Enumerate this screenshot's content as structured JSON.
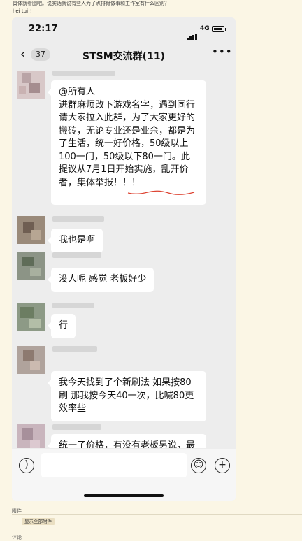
{
  "post": {
    "question": "具体就看图吧。说实话就说有些人为了点排骨做事和工作室有什么区别？",
    "subtext": "hei tui!!"
  },
  "status_bar": {
    "time": "22:17",
    "network": "4G"
  },
  "nav": {
    "back_count": "37",
    "title": "STSM交流群(11)",
    "more_label": "•••"
  },
  "messages": [
    {
      "text": "@所有人\n进群麻烦改下游戏名字，遇到同行请大家拉入此群，为了大家更好的搬砖，无论专业还是业余，都是为了生活，统一好价格，50级以上100一门，50级以下80一门。此提议从7月1日开始实施，乱开价者，集体举报！！！"
    },
    {
      "text": "我也是啊"
    },
    {
      "text": "没人呢 感觉  老板好少"
    },
    {
      "text": "行"
    },
    {
      "text": "我今天找到了个新刷法  如果按80刷 那我按今天40一次，比喊80更效率些"
    },
    {
      "text": "统一了价格，有没有老板另说，最起码不乱叫价了😂"
    }
  ],
  "input_bar": {
    "voice_icon": "voice-icon",
    "emoji_icon": "emoji-icon",
    "plus_icon": "plus-icon"
  },
  "attachments": {
    "label": "附件",
    "show_all_button": "显示全部附件"
  },
  "footer_cut": "评论"
}
